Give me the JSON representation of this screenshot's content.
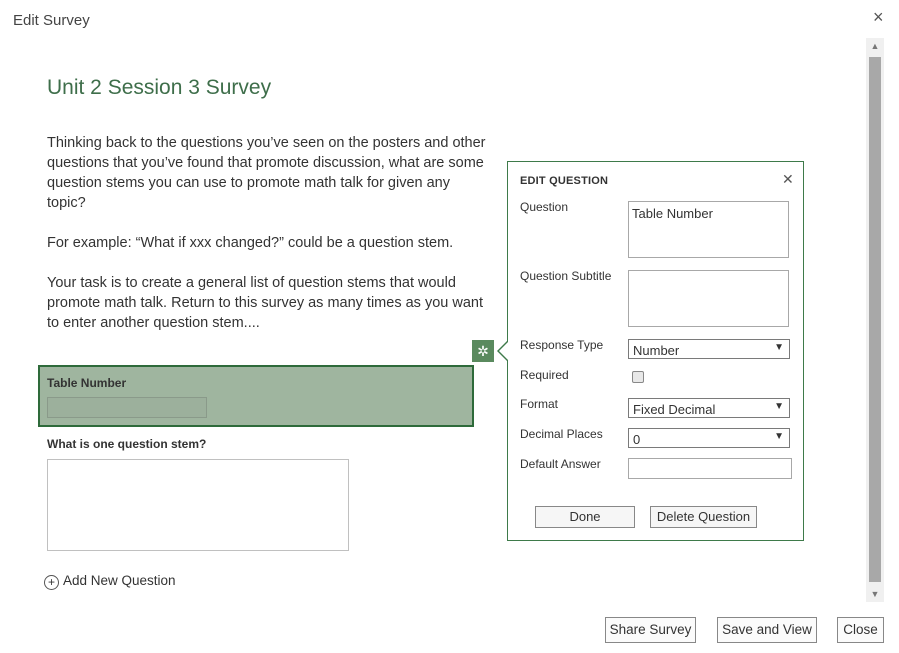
{
  "window": {
    "title": "Edit Survey",
    "close_icon": "×"
  },
  "survey": {
    "title": "Unit 2 Session 3 Survey",
    "paragraphs": [
      "Thinking back to the questions you’ve seen on the posters and other questions that you’ve found that promote discussion, what are some question stems you can use to promote math talk for given any topic?",
      "For example: “What if xxx changed?” could be a question stem.",
      "Your task is to create a general list of question stems that would promote math talk. Return to this survey as many times as you want to enter another question stem...."
    ]
  },
  "questions": [
    {
      "label": "Table Number",
      "selected": true
    },
    {
      "label": "What is one question stem?",
      "selected": false
    }
  ],
  "add_question": {
    "label": "Add New Question",
    "icon": "⊕"
  },
  "gear_icon": "✲",
  "edit_question": {
    "title": "EDIT QUESTION",
    "close_icon": "✕",
    "question_label": "Question",
    "question_value": "Table Number",
    "subtitle_label": "Question Subtitle",
    "subtitle_value": "",
    "response_type_label": "Response Type",
    "response_type_value": "Number",
    "required_label": "Required",
    "required_checked": false,
    "format_label": "Format",
    "format_value": "Fixed Decimal",
    "decimal_places_label": "Decimal Places",
    "decimal_places_value": "0",
    "default_answer_label": "Default Answer",
    "default_answer_value": "",
    "dropdown_arrow": "▼",
    "done_label": "Done",
    "delete_label": "Delete Question"
  },
  "footer": {
    "share_label": "Share Survey",
    "save_view_label": "Save and View",
    "close_label": "Close"
  },
  "colors": {
    "accent": "#3e6e4a",
    "selected_bg": "#9fb59f",
    "selected_border": "#2e6a3a"
  }
}
